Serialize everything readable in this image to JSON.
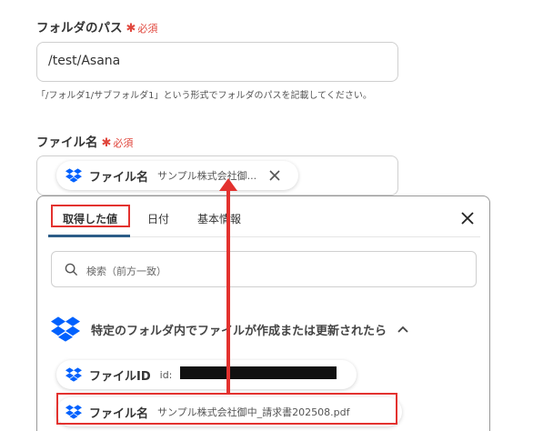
{
  "folder_path": {
    "label": "フォルダのパス",
    "required": "必須",
    "value": "/test/Asana",
    "help": "「/フォルダ1/サブフォルダ1」という形式でフォルダのパスを記載してください。"
  },
  "file_name": {
    "label": "ファイル名",
    "required": "必須",
    "chip_name": "ファイル名",
    "chip_value": "サンプル株式会社御..."
  },
  "popup": {
    "tabs": [
      "取得した値",
      "日付",
      "基本情報"
    ],
    "search_placeholder": "検索（前方一致）",
    "group_title": "特定のフォルダ内でファイルが作成または更新されたら",
    "items": [
      {
        "name": "ファイルID",
        "value": "id:"
      },
      {
        "name": "ファイル名",
        "value": "サンプル株式会社御中_請求書202508.pdf"
      }
    ]
  },
  "colors": {
    "required": "#e0463c",
    "highlight": "#e3322f",
    "dropbox": "#0061fe",
    "tab_underline": "#2c5d88"
  },
  "icons": [
    "dropbox-icon",
    "close-icon",
    "search-icon",
    "chevron-up-icon",
    "remove-icon"
  ]
}
